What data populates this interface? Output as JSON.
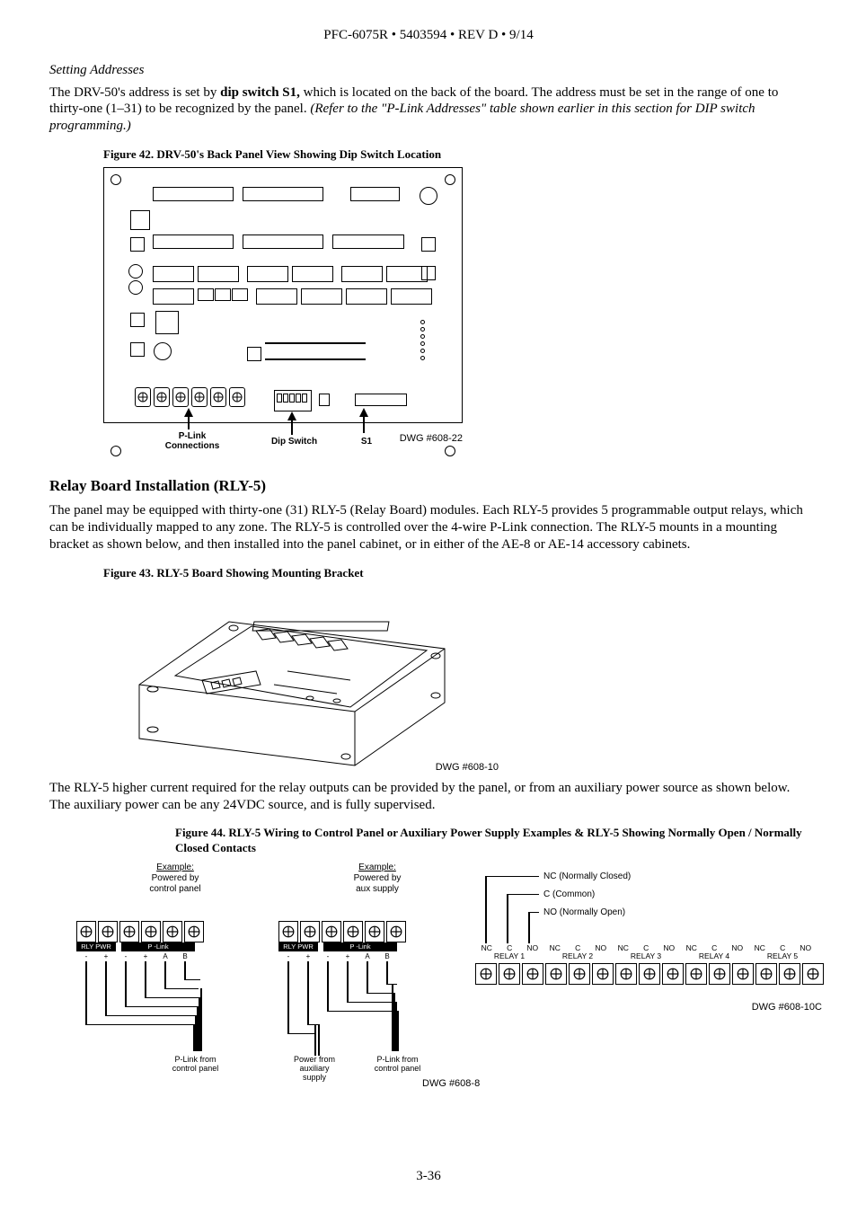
{
  "header": "PFC-6075R • 5403594 • REV D • 9/14",
  "pageNumber": "3-36",
  "subheading1": "Setting Addresses",
  "para1_a": "The DRV-50's address is set by ",
  "para1_b": "dip switch S1,",
  "para1_c": " which is located on the back of the board.  The address must be set in the range of one to thirty-one (1–31) to be recognized by the panel. ",
  "para1_d": "(Refer to the \"P-Link Addresses\" table shown earlier in this section for DIP switch programming.)",
  "fig42": {
    "caption": "Figure 42. DRV-50's Back Panel View Showing Dip Switch Location",
    "label_plink": "P-Link\nConnections",
    "label_dip": "Dip Switch",
    "label_s1": "S1",
    "dwg": "DWG #608-22"
  },
  "section2_title": "Relay Board Installation (RLY-5)",
  "para2": "The panel may be equipped with thirty-one (31) RLY-5 (Relay Board) modules. Each RLY-5 provides 5 programmable output relays, which can be individually mapped to any zone. The RLY-5 is controlled over the 4-wire P-Link connection. The RLY-5 mounts in a mounting bracket as shown below, and then installed into the panel cabinet, or in either of the AE-8 or AE-14 accessory cabinets.",
  "fig43": {
    "caption": "Figure 43. RLY-5 Board Showing Mounting Bracket",
    "dwg": "DWG #608-10"
  },
  "para3": "The RLY-5 higher current required for the relay outputs can be provided by the panel, or from an auxiliary power source as shown below. The auxiliary power can be any 24VDC source, and is fully supervised.",
  "fig44": {
    "caption": "Figure 44.  RLY-5 Wiring to Control Panel or Auxiliary Power Supply Examples & RLY-5 Showing Normally Open / Normally Closed Contacts",
    "ex1_head": "Example:",
    "ex1_l1": "Powered by",
    "ex1_l2": "control panel",
    "ex2_head": "Example:",
    "ex2_l1": "Powered by",
    "ex2_l2": "aux supply",
    "rlypwr": "RLY PWR",
    "plink": "P -Link",
    "pins": [
      "-",
      "+",
      "-",
      "+",
      "A",
      "B"
    ],
    "cap1": "P-Link from\ncontrol panel",
    "cap2a": "Power from\nauxiliary\nsupply",
    "cap2b": "P-Link from\ncontrol panel",
    "dwg_left": "DWG #608-8",
    "legend_nc": "NC (Normally Closed)",
    "legend_c": "C (Common)",
    "legend_no": "NO (Normally Open)",
    "relay_cols": [
      "NC",
      "C",
      "NO"
    ],
    "relays": [
      "RELAY 1",
      "RELAY 2",
      "RELAY 3",
      "RELAY 4",
      "RELAY 5"
    ],
    "dwg_right": "DWG #608-10C"
  }
}
